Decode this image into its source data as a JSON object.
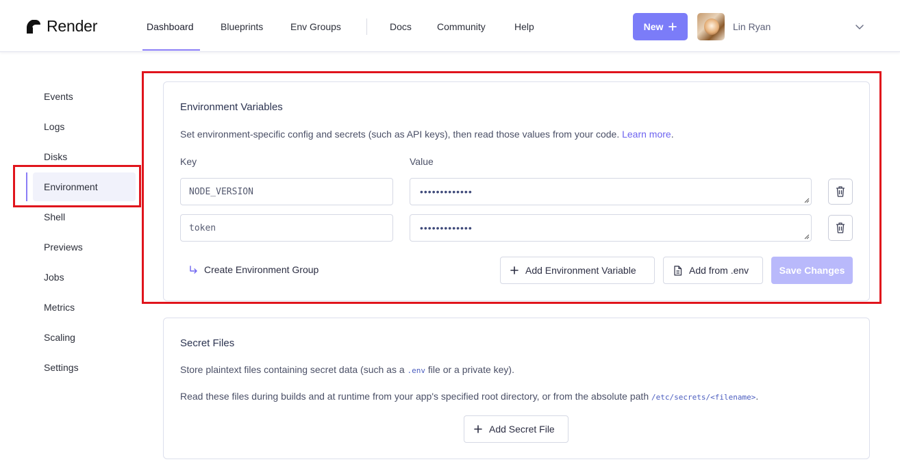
{
  "brand": {
    "name": "Render"
  },
  "nav": {
    "items": [
      "Dashboard",
      "Blueprints",
      "Env Groups",
      "Docs",
      "Community",
      "Help"
    ],
    "active": "Dashboard",
    "new_button": "New"
  },
  "user": {
    "name": "Lin Ryan"
  },
  "sidebar": {
    "items": [
      "Events",
      "Logs",
      "Disks",
      "Environment",
      "Shell",
      "Previews",
      "Jobs",
      "Metrics",
      "Scaling",
      "Settings"
    ],
    "active": "Environment"
  },
  "env_vars": {
    "title": "Environment Variables",
    "description": "Set environment-specific config and secrets (such as API keys), then read those values from your code.",
    "learn_more": "Learn more",
    "description_end": ".",
    "key_label": "Key",
    "value_label": "Value",
    "rows": [
      {
        "key": "NODE_VERSION",
        "value": "•••••••••••••"
      },
      {
        "key": "token",
        "value": "•••••••••••••"
      }
    ],
    "create_group": "Create Environment Group",
    "add_variable": "Add Environment Variable",
    "add_from_env": "Add from .env",
    "save_changes": "Save Changes"
  },
  "secret_files": {
    "title": "Secret Files",
    "line1_before": "Store plaintext files containing secret data (such as a",
    "line1_code": ".env",
    "line1_after": "file or a private key).",
    "line2_before": "Read these files during builds and at runtime from your app's specified root directory, or from the absolute path",
    "line2_code": "/etc/secrets/<filename>",
    "line2_after": ".",
    "add_button": "Add Secret File"
  },
  "colors": {
    "accent": "#7b7cf8",
    "accent_disabled": "#b9b9fb",
    "highlight": "#e0141c"
  },
  "icons": [
    "render-logo-icon",
    "plus-icon",
    "chevron-down-icon",
    "trash-icon",
    "return-arrow-icon",
    "file-icon"
  ]
}
